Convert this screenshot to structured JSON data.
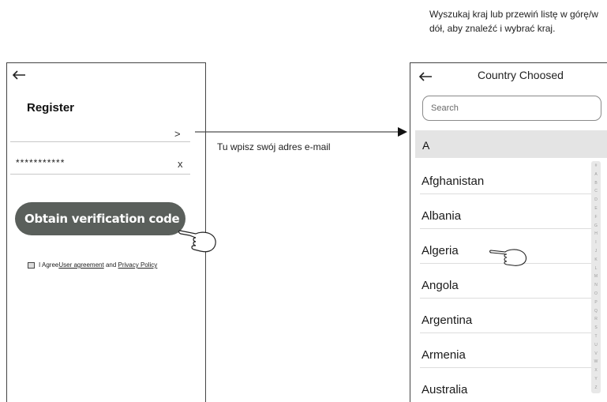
{
  "callouts": {
    "email_hint": "Tu wpisz swój adres e-mail",
    "country_hint": "Wyszukaj kraj lub przewiń listę w górę/w dół, aby znaleźć i wybrać kraj."
  },
  "register_screen": {
    "back_icon": "left-arrow-icon",
    "title": "Register",
    "email_field": {
      "value": "",
      "action_glyph": ">"
    },
    "password_field": {
      "value": "***********",
      "clear_glyph": "x"
    },
    "obtain_button_label": "Obtain verification code",
    "agreement": {
      "prefix": "I Agree ",
      "user_agreement": "User agreement",
      "connector": " and ",
      "privacy_policy": "Privacy Policy"
    }
  },
  "country_screen": {
    "back_icon": "left-arrow-icon",
    "title": "Country Choosed",
    "search_placeholder": "Search",
    "section_letter": "A",
    "countries": [
      "Afghanistan",
      "Albania",
      "Algeria",
      "Angola",
      "Argentina",
      "Armenia",
      "Australia"
    ],
    "index_letters": [
      "#",
      "A",
      "B",
      "C",
      "D",
      "E",
      "F",
      "G",
      "H",
      "I",
      "J",
      "K",
      "L",
      "M",
      "N",
      "O",
      "P",
      "Q",
      "R",
      "S",
      "T",
      "U",
      "V",
      "W",
      "X",
      "Y",
      "Z"
    ]
  },
  "colors": {
    "button_bg": "#5a5f5b",
    "header_bg": "#e4e4e4",
    "arrow": "#111111"
  }
}
